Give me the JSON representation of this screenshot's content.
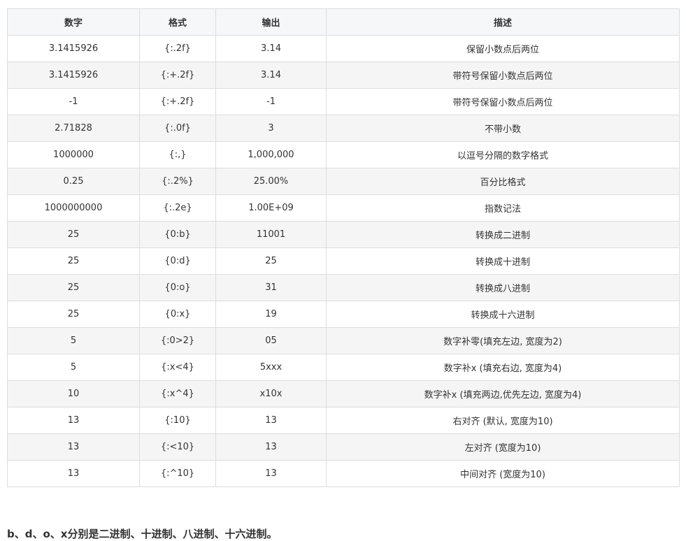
{
  "table": {
    "headers": [
      "数字",
      "格式",
      "输出",
      "描述"
    ],
    "rows": [
      [
        "3.1415926",
        "{:.2f}",
        "3.14",
        "保留小数点后两位"
      ],
      [
        "3.1415926",
        "{:+.2f}",
        "3.14",
        "带符号保留小数点后两位"
      ],
      [
        "-1",
        "{:+.2f}",
        "-1",
        "带符号保留小数点后两位"
      ],
      [
        "2.71828",
        "{:.0f}",
        "3",
        "不带小数"
      ],
      [
        "1000000",
        "{:,}",
        "1,000,000",
        "以逗号分隔的数字格式"
      ],
      [
        "0.25",
        "{:.2%}",
        "25.00%",
        "百分比格式"
      ],
      [
        "1000000000",
        "{:.2e}",
        "1.00E+09",
        "指数记法"
      ],
      [
        "25",
        "{0:b}",
        "11001",
        "转换成二进制"
      ],
      [
        "25",
        "{0:d}",
        "25",
        "转换成十进制"
      ],
      [
        "25",
        "{0:o}",
        "31",
        "转换成八进制"
      ],
      [
        "25",
        "{0:x}",
        "19",
        "转换成十六进制"
      ],
      [
        "5",
        "{:0>2}",
        "05",
        "数字补零(填充左边, 宽度为2)"
      ],
      [
        "5",
        "{:x<4}",
        "5xxx",
        "数字补x (填充右边, 宽度为4)"
      ],
      [
        "10",
        "{:x^4}",
        "x10x",
        "数字补x (填充两边,优先左边, 宽度为4)"
      ],
      [
        "13",
        "{:10}",
        "13",
        "右对齐 (默认, 宽度为10)"
      ],
      [
        "13",
        "{:<10}",
        "13",
        "左对齐 (宽度为10)"
      ],
      [
        "13",
        "{:^10}",
        "13",
        "中间对齐 (宽度为10)"
      ]
    ]
  },
  "note": "b、d、o、x分别是二进制、十进制、八进制、十六进制。"
}
